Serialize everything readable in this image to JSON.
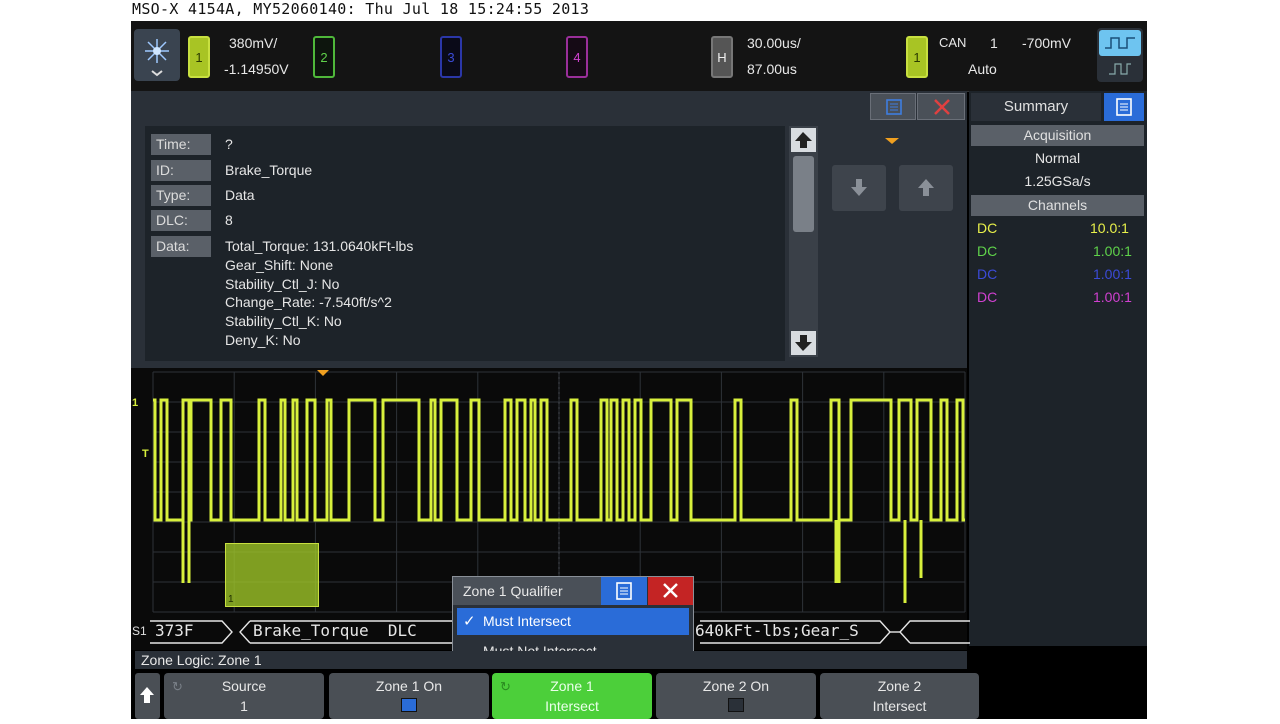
{
  "header": {
    "text": "MSO-X 4154A, MY52060140: Thu Jul 18 15:24:55 2013"
  },
  "topbar": {
    "ch1": {
      "label": "1",
      "scale": "380mV/",
      "offset": "-1.14950V"
    },
    "ch2": {
      "label": "2"
    },
    "ch3": {
      "label": "3"
    },
    "ch4": {
      "label": "4"
    },
    "horizontal": {
      "label": "H",
      "scale": "30.00us/",
      "delay": "87.00us"
    },
    "trigger": {
      "source": "1",
      "type": "CAN",
      "num": "1",
      "level": "-700mV",
      "mode": "Auto"
    }
  },
  "decode": {
    "rows": [
      {
        "label": "Time:",
        "value": "?"
      },
      {
        "label": "ID:",
        "value": "Brake_Torque"
      },
      {
        "label": "Type:",
        "value": "Data"
      },
      {
        "label": "DLC:",
        "value": "8"
      },
      {
        "label": "Data:",
        "value": "Total_Torque: 131.0640kFt-lbs"
      }
    ],
    "data_lines": [
      "Gear_Shift: None",
      "Stability_Ctl_J: No",
      "Change_Rate: -7.540ft/s^2",
      "Stability_Ctl_K: No",
      "Deny_K: No"
    ]
  },
  "summary": {
    "title": "Summary",
    "acq_header": "Acquisition",
    "acq_mode": "Normal",
    "sample_rate": "1.25GSa/s",
    "channels_header": "Channels",
    "channels": [
      {
        "coupling": "DC",
        "probe": "10.0:1",
        "color": "#e8f04a"
      },
      {
        "coupling": "DC",
        "probe": "1.00:1",
        "color": "#5fd24a"
      },
      {
        "coupling": "DC",
        "probe": "1.00:1",
        "color": "#3b4bd8"
      },
      {
        "coupling": "DC",
        "probe": "1.00:1",
        "color": "#d040d0"
      }
    ]
  },
  "waveform": {
    "ch1_marker": "1",
    "trig_marker": "T",
    "zone_label": "1",
    "bus_label": "S1",
    "bus_segments": {
      "s1": "373F",
      "s2": "Brake_Torque  DLC",
      "s3": "640kFt-lbs;Gear_S"
    }
  },
  "qualifier_menu": {
    "title": "Zone 1 Qualifier",
    "options": [
      {
        "label": "Must Intersect",
        "selected": true
      },
      {
        "label": "Must Not Intersect",
        "selected": false
      }
    ]
  },
  "zone_logic": {
    "text": "Zone Logic: Zone 1"
  },
  "softkeys": [
    {
      "title": "Source",
      "value": "1"
    },
    {
      "title": "Zone 1 On",
      "value": ""
    },
    {
      "title": "Zone 1",
      "value": "Intersect"
    },
    {
      "title": "Zone 2 On",
      "value": ""
    },
    {
      "title": "Zone 2",
      "value": "Intersect"
    }
  ],
  "colors": {
    "ch1": "#d8f03c",
    "ch2": "#5fd24a",
    "ch3": "#3b4bd8",
    "ch4": "#d040d0",
    "accent": "#2a6cd8",
    "active_key": "#4ccf3a"
  }
}
